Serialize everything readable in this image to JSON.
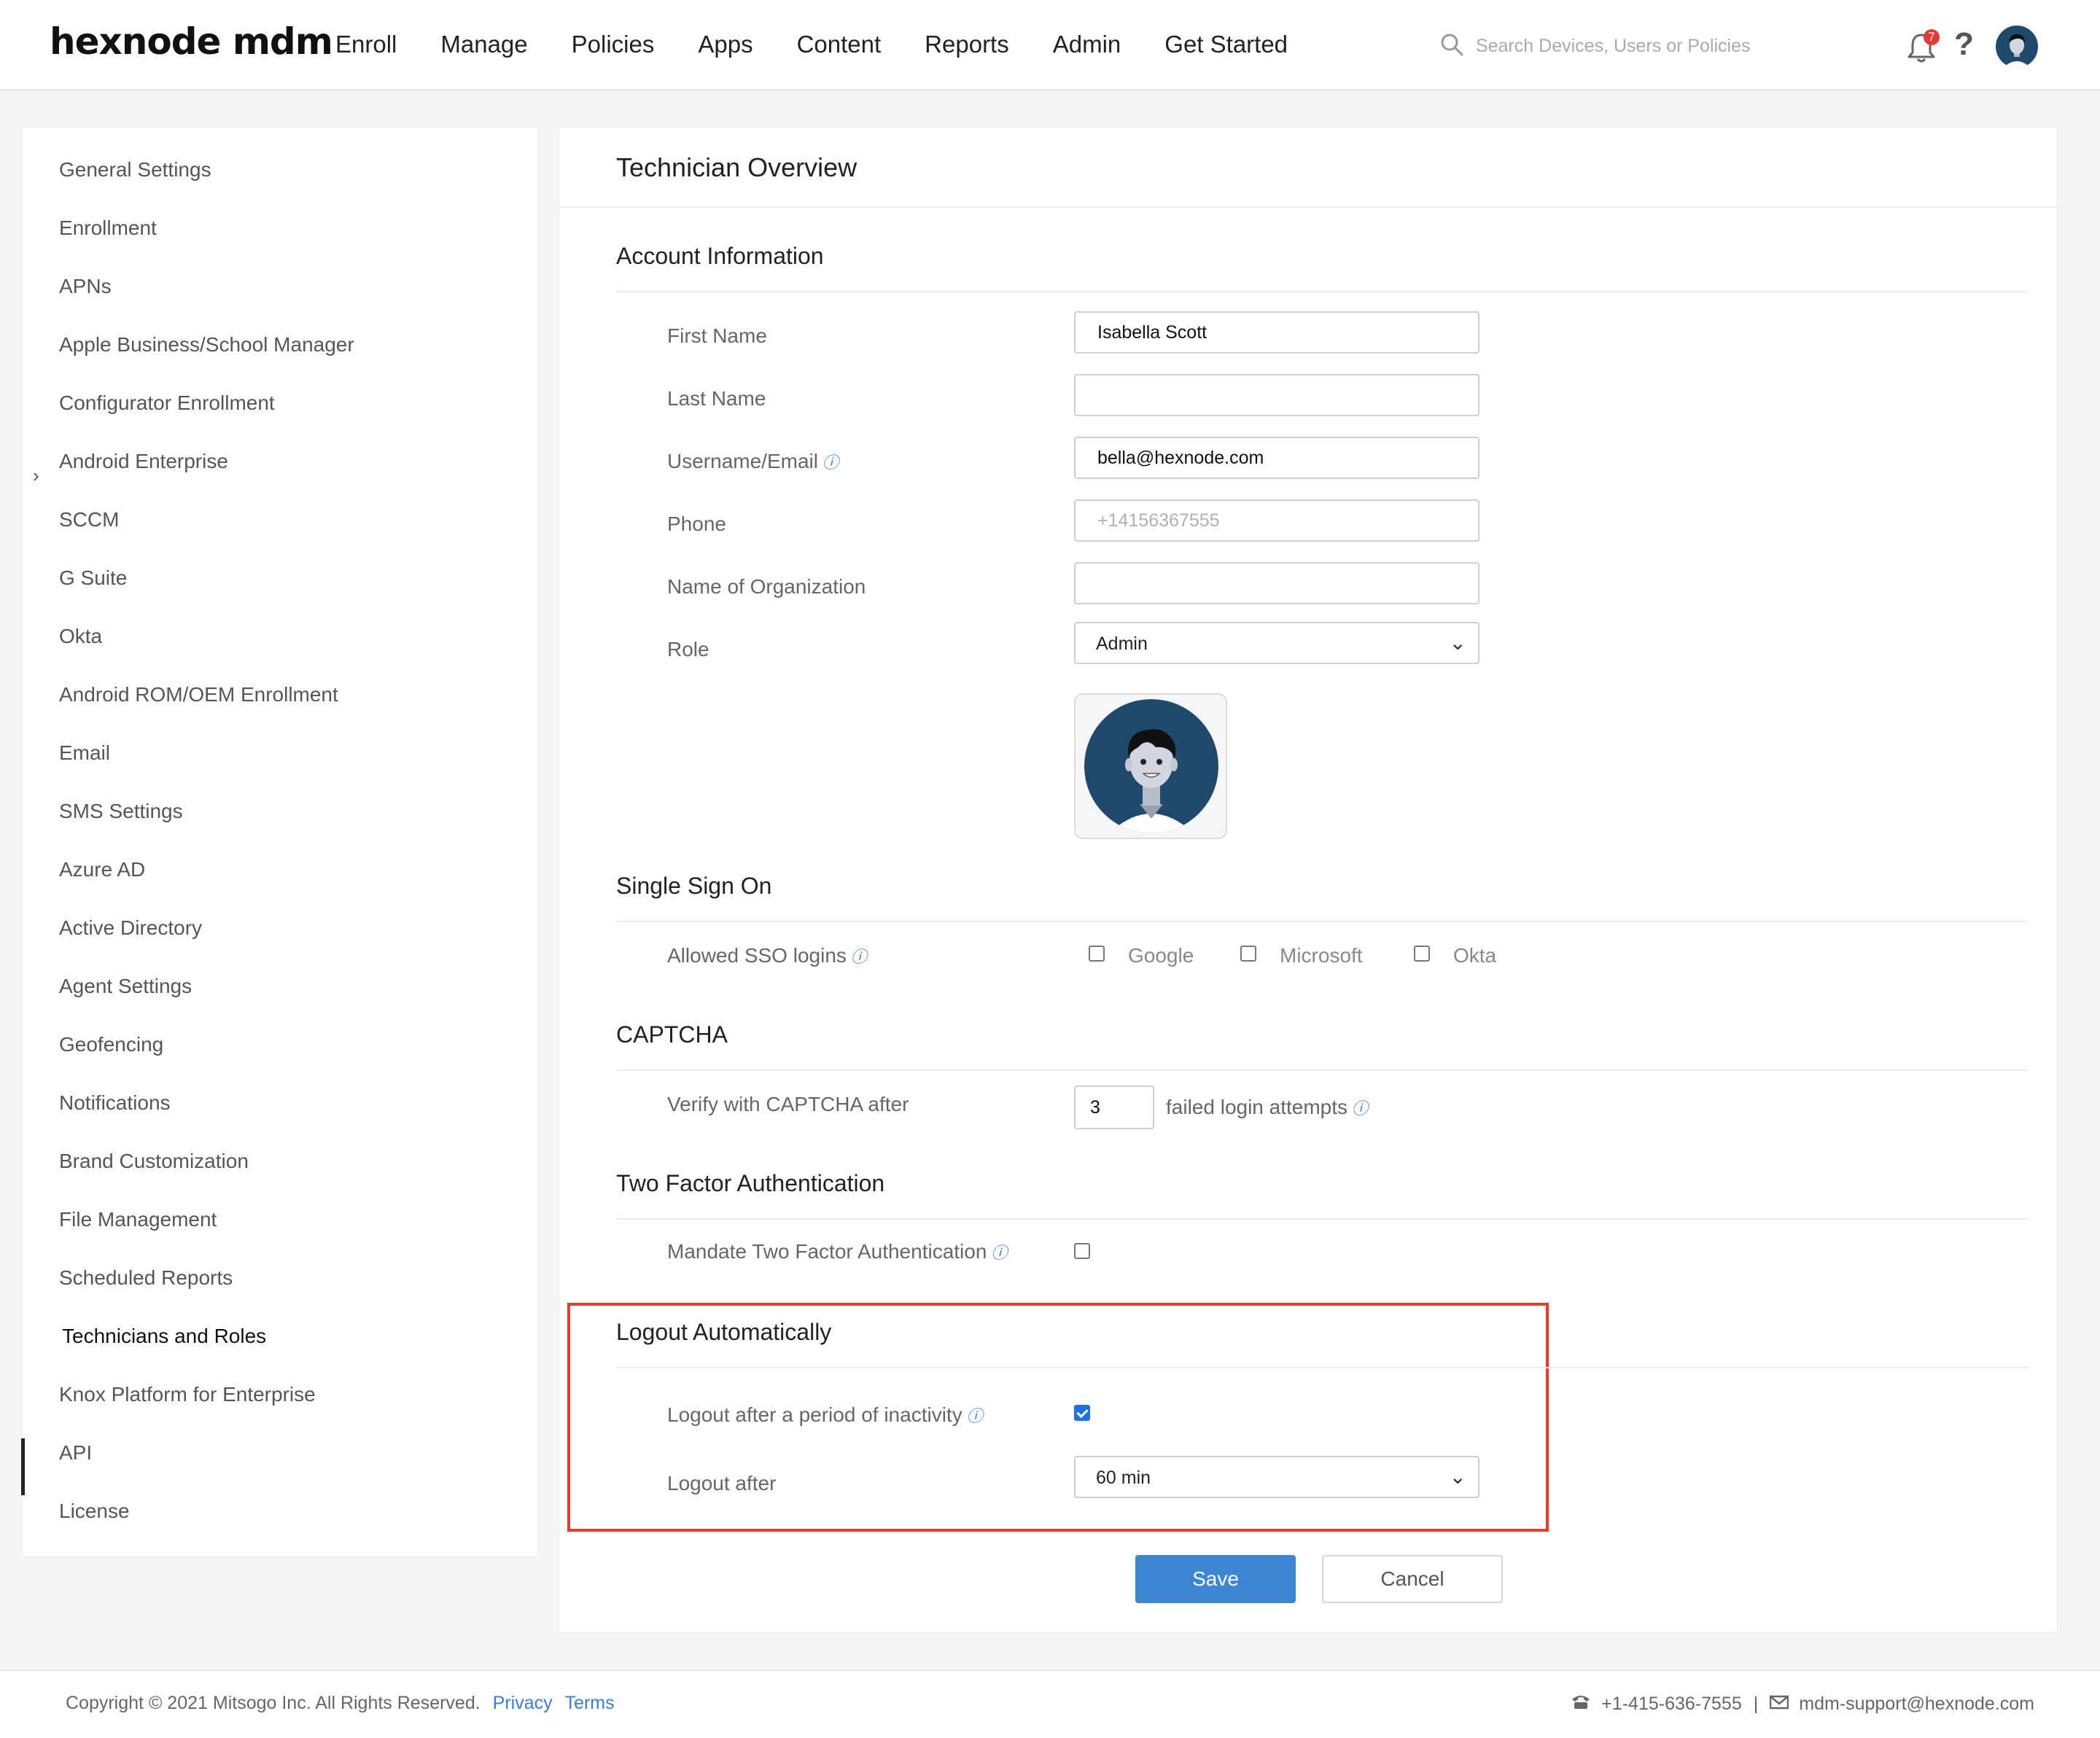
{
  "header": {
    "logo": "hexnode mdm",
    "nav": [
      "Enroll",
      "Manage",
      "Policies",
      "Apps",
      "Content",
      "Reports",
      "Admin",
      "Get Started"
    ],
    "search_placeholder": "Search Devices, Users or Policies",
    "notification_count": "7",
    "help_label": "?"
  },
  "sidebar": {
    "items": [
      {
        "label": "General Settings"
      },
      {
        "label": "Enrollment"
      },
      {
        "label": "APNs"
      },
      {
        "label": "Apple Business/School Manager"
      },
      {
        "label": "Configurator Enrollment"
      },
      {
        "label": "Android Enterprise"
      },
      {
        "label": "SCCM"
      },
      {
        "label": "G Suite"
      },
      {
        "label": "Okta"
      },
      {
        "label": "Android ROM/OEM Enrollment"
      },
      {
        "label": "Email"
      },
      {
        "label": "SMS Settings"
      },
      {
        "label": "Azure AD"
      },
      {
        "label": "Active Directory"
      },
      {
        "label": "Agent Settings"
      },
      {
        "label": "Geofencing"
      },
      {
        "label": "Notifications"
      },
      {
        "label": "Brand Customization"
      },
      {
        "label": "File Management"
      },
      {
        "label": "Scheduled Reports"
      },
      {
        "label": "Technicians and Roles"
      },
      {
        "label": "Knox Platform for Enterprise"
      },
      {
        "label": "API"
      },
      {
        "label": "License"
      }
    ],
    "active": "Technicians and Roles"
  },
  "main": {
    "title": "Technician Overview",
    "account": {
      "section_title": "Account Information",
      "first_name_label": "First Name",
      "first_name_value": "Isabella Scott",
      "last_name_label": "Last Name",
      "last_name_value": "",
      "username_label": "Username/Email",
      "username_value": "bella@hexnode.com",
      "phone_label": "Phone",
      "phone_placeholder": "+14156367555",
      "org_label": "Name of Organization",
      "org_value": "",
      "role_label": "Role",
      "role_value": "Admin"
    },
    "sso": {
      "section_title": "Single Sign On",
      "allowed_label": "Allowed SSO logins",
      "options": [
        {
          "label": "Google",
          "checked": false
        },
        {
          "label": "Microsoft",
          "checked": false
        },
        {
          "label": "Okta",
          "checked": false
        }
      ]
    },
    "captcha": {
      "section_title": "CAPTCHA",
      "verify_label": "Verify with CAPTCHA after",
      "attempts_value": "3",
      "attempts_suffix": "failed login attempts"
    },
    "two_factor": {
      "section_title": "Two Factor Authentication",
      "mandate_label": "Mandate Two Factor Authentication",
      "checked": false
    },
    "logout": {
      "section_title": "Logout Automatically",
      "inactivity_label": "Logout after a period of inactivity",
      "inactivity_checked": true,
      "after_label": "Logout after",
      "after_value": "60 min"
    },
    "buttons": {
      "save": "Save",
      "cancel": "Cancel"
    }
  },
  "footer": {
    "copyright": "Copyright © 2021 Mitsogo Inc. All Rights Reserved.",
    "privacy": "Privacy",
    "terms": "Terms",
    "phone": "+1-415-636-7555",
    "separator": "|",
    "email": "mdm-support@hexnode.com"
  },
  "colors": {
    "accent": "#3d86d2",
    "highlight_border": "#e8392b",
    "link": "#3a7bd5",
    "checkbox_checked": "#1a73e8"
  },
  "icons": [
    "search-icon",
    "bell-icon",
    "help-icon",
    "user-avatar-icon",
    "chevron-right-icon",
    "chevron-down-icon",
    "info-icon",
    "phone-icon",
    "mail-icon"
  ]
}
